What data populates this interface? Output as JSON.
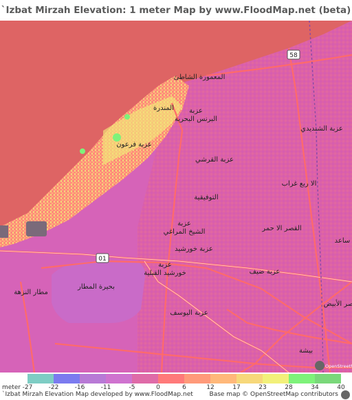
{
  "title": "`Izbat Mirzah Elevation: 1 meter Map by www.FloodMap.net (beta)",
  "map": {
    "labels": [
      {
        "id": "maamoura",
        "text": "المعمورة الشاطئ"
      },
      {
        "id": "mandara",
        "text": "المندرة"
      },
      {
        "id": "ezba-bars",
        "text": "عزبة"
      },
      {
        "id": "bars-bahria",
        "text": "البرنس البحرية"
      },
      {
        "id": "ezba-faraon",
        "text": "عزبة فرعون"
      },
      {
        "id": "ezba-shendidi",
        "text": "عزبة الشنديدي"
      },
      {
        "id": "ezba-qorashi",
        "text": "عزبة القرشي"
      },
      {
        "id": "arbaa-ghorab",
        "text": "الا ربع غراب"
      },
      {
        "id": "tawfiqia",
        "text": "التوفيقية"
      },
      {
        "id": "ezba-sheikh-1",
        "text": "عزبة"
      },
      {
        "id": "sheikh-maraghi",
        "text": "الشيخ المراغي"
      },
      {
        "id": "qasr-ahmar",
        "text": "القصر الا حمر"
      },
      {
        "id": "ezba-khorshid",
        "text": "عزبة خورشيد"
      },
      {
        "id": "ezba-dayf",
        "text": "عزبة ضيف"
      },
      {
        "id": "ezba-khorshid-2",
        "text": "عزبة"
      },
      {
        "id": "khorshid-qibliya",
        "text": "خورشيد القبلية"
      },
      {
        "id": "buhayrat-matar",
        "text": "بحيرة المطار"
      },
      {
        "id": "matar-nozha",
        "text": "مطار النزهة"
      },
      {
        "id": "ezba-yusuf",
        "text": "عزبة اليوسف"
      },
      {
        "id": "qasr-abyad",
        "text": "قصر الأبيض"
      },
      {
        "id": "sa3d",
        "text": "ساعد"
      },
      {
        "id": "bisha",
        "text": "بيشة"
      }
    ],
    "road_shields": [
      {
        "id": "r58",
        "text": "58"
      },
      {
        "id": "r01",
        "text": "01"
      }
    ],
    "osm_logo_text": "OpenStreetMap"
  },
  "legend": {
    "unit": "meter",
    "ticks": [
      "-27",
      "-22",
      "-16",
      "-11",
      "-5",
      "0",
      "6",
      "12",
      "17",
      "23",
      "28",
      "34",
      "40"
    ],
    "colors": [
      "#7ecdc4",
      "#7b7bef",
      "#b87ad6",
      "#cf73cf",
      "#df6ba8",
      "#ff7a7a",
      "#ff9a7a",
      "#ffb87a",
      "#f7d87a",
      "#f2f07a",
      "#7ef27a",
      "#7ad87a"
    ]
  },
  "footer": {
    "left": "`Izbat Mirzah Elevation Map developed by www.FloodMap.net",
    "right": "Base map © OpenStreetMap contributors"
  }
}
